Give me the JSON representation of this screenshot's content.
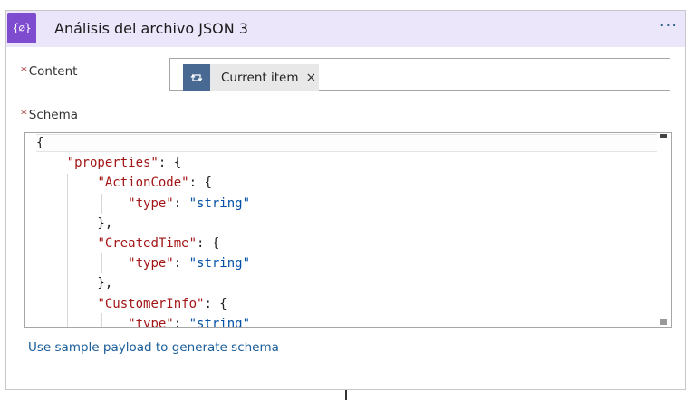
{
  "header": {
    "icon_glyph": "{⌀}",
    "title": "Análisis del archivo JSON 3",
    "more_label": "···",
    "accent_color": "#7e4ccf",
    "background_color": "#ece6fb"
  },
  "content_field": {
    "required_mark": "*",
    "label": "Content",
    "token": {
      "icon": "loop-icon",
      "label": "Current item",
      "close_label": "×",
      "icon_color": "#486991"
    }
  },
  "schema_field": {
    "required_mark": "*",
    "label": "Schema",
    "code_lines": [
      [
        {
          "t": "{",
          "c": "p"
        }
      ],
      [
        {
          "t": "    ",
          "c": "p"
        },
        {
          "t": "\"properties\"",
          "c": "k"
        },
        {
          "t": ": {",
          "c": "p"
        }
      ],
      [
        {
          "t": "        ",
          "c": "p"
        },
        {
          "t": "\"ActionCode\"",
          "c": "k"
        },
        {
          "t": ": {",
          "c": "p"
        }
      ],
      [
        {
          "t": "            ",
          "c": "p"
        },
        {
          "t": "\"type\"",
          "c": "k"
        },
        {
          "t": ": ",
          "c": "p"
        },
        {
          "t": "\"string\"",
          "c": "s"
        }
      ],
      [
        {
          "t": "        },",
          "c": "p"
        }
      ],
      [
        {
          "t": "        ",
          "c": "p"
        },
        {
          "t": "\"CreatedTime\"",
          "c": "k"
        },
        {
          "t": ": {",
          "c": "p"
        }
      ],
      [
        {
          "t": "            ",
          "c": "p"
        },
        {
          "t": "\"type\"",
          "c": "k"
        },
        {
          "t": ": ",
          "c": "p"
        },
        {
          "t": "\"string\"",
          "c": "s"
        }
      ],
      [
        {
          "t": "        },",
          "c": "p"
        }
      ],
      [
        {
          "t": "        ",
          "c": "p"
        },
        {
          "t": "\"CustomerInfo\"",
          "c": "k"
        },
        {
          "t": ": {",
          "c": "p"
        }
      ],
      [
        {
          "t": "            ",
          "c": "p"
        },
        {
          "t": "\"type\"",
          "c": "k"
        },
        {
          "t": ": ",
          "c": "p"
        },
        {
          "t": "\"string\"",
          "c": "s"
        }
      ]
    ]
  },
  "sample_link": "Use sample payload to generate schema"
}
